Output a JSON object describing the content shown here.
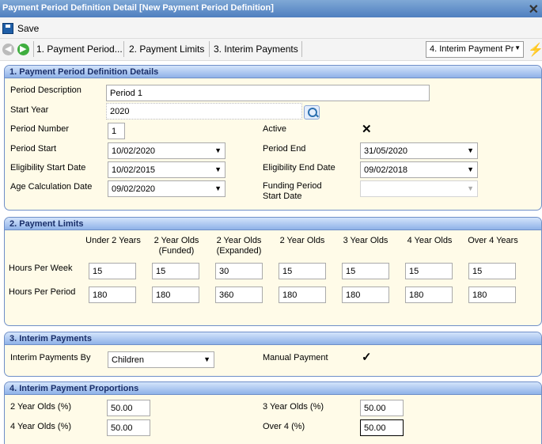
{
  "window": {
    "title": "Payment Period Definition Detail [New Payment Period Definition]"
  },
  "toolbar": {
    "save_label": "Save"
  },
  "nav": {
    "tabs": [
      "1. Payment Period...",
      "2. Payment Limits",
      "3. Interim Payments"
    ],
    "jump_selected": "4. Interim Payment Pr"
  },
  "section1": {
    "title": "1. Payment Period Definition Details",
    "period_description_label": "Period Description",
    "period_description_value": "Period 1",
    "start_year_label": "Start Year",
    "start_year_value": "2020",
    "period_number_label": "Period Number",
    "period_number_value": "1",
    "active_label": "Active",
    "active_checked": true,
    "period_start_label": "Period Start",
    "period_start_value": "10/02/2020",
    "period_end_label": "Period End",
    "period_end_value": "31/05/2020",
    "elig_start_label": "Eligibility Start Date",
    "elig_start_value": "10/02/2015",
    "elig_end_label": "Eligibility End Date",
    "elig_end_value": "09/02/2018",
    "age_calc_label": "Age Calculation Date",
    "age_calc_value": "09/02/2020",
    "funding_label_1": "Funding Period",
    "funding_label_2": "Start Date",
    "funding_value": ""
  },
  "section2": {
    "title": "2. Payment Limits",
    "columns": [
      [
        "Under 2 Years"
      ],
      [
        "2 Year Olds",
        "(Funded)"
      ],
      [
        "2 Year Olds",
        "(Expanded)"
      ],
      [
        "2 Year Olds"
      ],
      [
        "3 Year Olds"
      ],
      [
        "4 Year Olds"
      ],
      [
        "Over 4 Years"
      ]
    ],
    "rows": [
      {
        "label": "Hours Per Week",
        "values": [
          "15",
          "15",
          "30",
          "15",
          "15",
          "15",
          "15"
        ]
      },
      {
        "label": "Hours Per Period",
        "values": [
          "180",
          "180",
          "360",
          "180",
          "180",
          "180",
          "180"
        ]
      }
    ]
  },
  "section3": {
    "title": "3. Interim Payments",
    "by_label": "Interim Payments By",
    "by_value": "Children",
    "manual_label": "Manual Payment",
    "manual_checked": true
  },
  "section4": {
    "title": "4. Interim Payment Proportions",
    "two_label": "2 Year Olds (%)",
    "two_value": "50.00",
    "three_label": "3 Year Olds (%)",
    "three_value": "50.00",
    "four_label": "4 Year Olds (%)",
    "four_value": "50.00",
    "over4_label": "Over 4 (%)",
    "over4_value": "50.00"
  },
  "icons": {
    "active": "cross-mark-icon",
    "manual": "check-mark-icon"
  },
  "colors": {
    "panel_bg": "#fffbe8",
    "panel_header": "#8fb2e8",
    "title_bar": "#4f7fbf"
  }
}
